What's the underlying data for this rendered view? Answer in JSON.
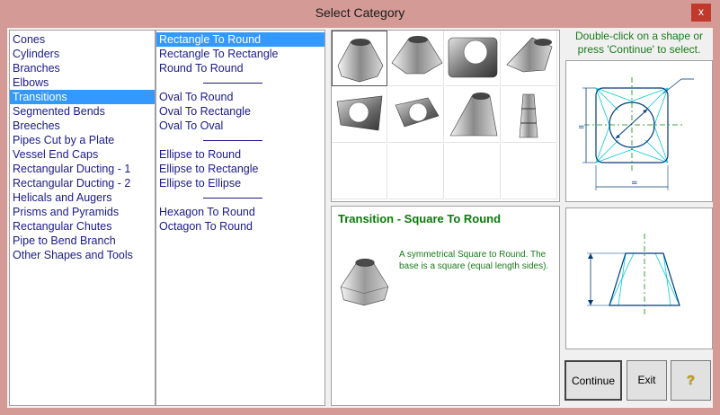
{
  "window": {
    "title": "Select Category",
    "close_glyph": "x"
  },
  "categories": {
    "items": [
      "Cones",
      "Cylinders",
      "Branches",
      "Elbows",
      "Transitions",
      "Segmented Bends",
      "Breeches",
      "Pipes Cut by a Plate",
      "Vessel End Caps",
      "Rectangular Ducting - 1",
      "Rectangular Ducting - 2",
      "Helicals and Augers",
      "Prisms and Pyramids",
      "Rectangular Chutes",
      "Pipe to Bend Branch",
      "Other Shapes and Tools"
    ],
    "selected": "Transitions"
  },
  "subtypes": {
    "group1": [
      "Rectangle To Round",
      "Rectangle To Rectangle",
      "Round To Round"
    ],
    "group2": [
      "Oval To Round",
      "Oval To Rectangle",
      "Oval To Oval"
    ],
    "group3": [
      "Ellipse to Round",
      "Ellipse to Rectangle",
      "Ellipse to Ellipse"
    ],
    "group4": [
      "Hexagon To Round",
      "Octagon To Round"
    ],
    "selected": "Rectangle To Round"
  },
  "hint": "Double-click on a shape or press 'Continue' to select.",
  "description": {
    "title": "Transition - Square To Round",
    "text": "A symmetrical Square to Round. The base is a square (equal length sides)."
  },
  "drawing": {
    "eq1": "=",
    "eq2": "="
  },
  "buttons": {
    "continue": "Continue",
    "exit": "Exit",
    "help_glyph": "?"
  },
  "shapes": [
    "square-to-round-icon",
    "rect-to-round-icon",
    "rect-to-rect-icon",
    "offset-transition-icon",
    "oval-to-round-icon",
    "oval-to-rect-icon",
    "round-to-round-icon",
    "stacked-transition-icon"
  ]
}
